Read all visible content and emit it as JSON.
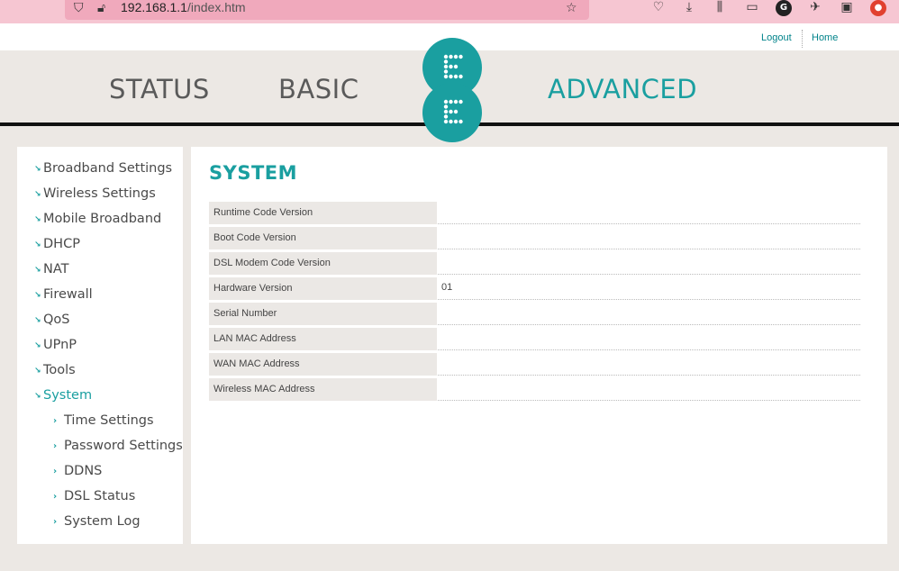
{
  "browser": {
    "url_host": "192.168.1.1",
    "url_path": "/index.htm"
  },
  "header": {
    "logout_label": "Logout",
    "home_label": "Home"
  },
  "nav": {
    "status_label": "STATUS",
    "basic_label": "BASIC",
    "advanced_label": "ADVANCED",
    "logo_letters": [
      "E",
      "E"
    ]
  },
  "sidebar": {
    "items": [
      {
        "label": "Broadband Settings"
      },
      {
        "label": "Wireless Settings"
      },
      {
        "label": "Mobile Broadband"
      },
      {
        "label": "DHCP"
      },
      {
        "label": "NAT"
      },
      {
        "label": "Firewall"
      },
      {
        "label": "QoS"
      },
      {
        "label": "UPnP"
      },
      {
        "label": "Tools"
      },
      {
        "label": "System"
      }
    ],
    "subitems": [
      {
        "label": "Time Settings"
      },
      {
        "label": "Password Settings"
      },
      {
        "label": "DDNS"
      },
      {
        "label": "DSL Status"
      },
      {
        "label": "System Log"
      }
    ]
  },
  "main": {
    "title": "SYSTEM",
    "rows": [
      {
        "label": "Runtime Code Version",
        "value": ""
      },
      {
        "label": "Boot Code Version",
        "value": ""
      },
      {
        "label": "DSL Modem Code Version",
        "value": ""
      },
      {
        "label": "Hardware Version",
        "value": "01"
      },
      {
        "label": "Serial Number",
        "value": ""
      },
      {
        "label": "LAN MAC Address",
        "value": ""
      },
      {
        "label": "WAN MAC Address",
        "value": ""
      },
      {
        "label": "Wireless MAC Address",
        "value": ""
      }
    ]
  },
  "colors": {
    "accent": "#1a9fa0",
    "background": "#ece8e4"
  }
}
